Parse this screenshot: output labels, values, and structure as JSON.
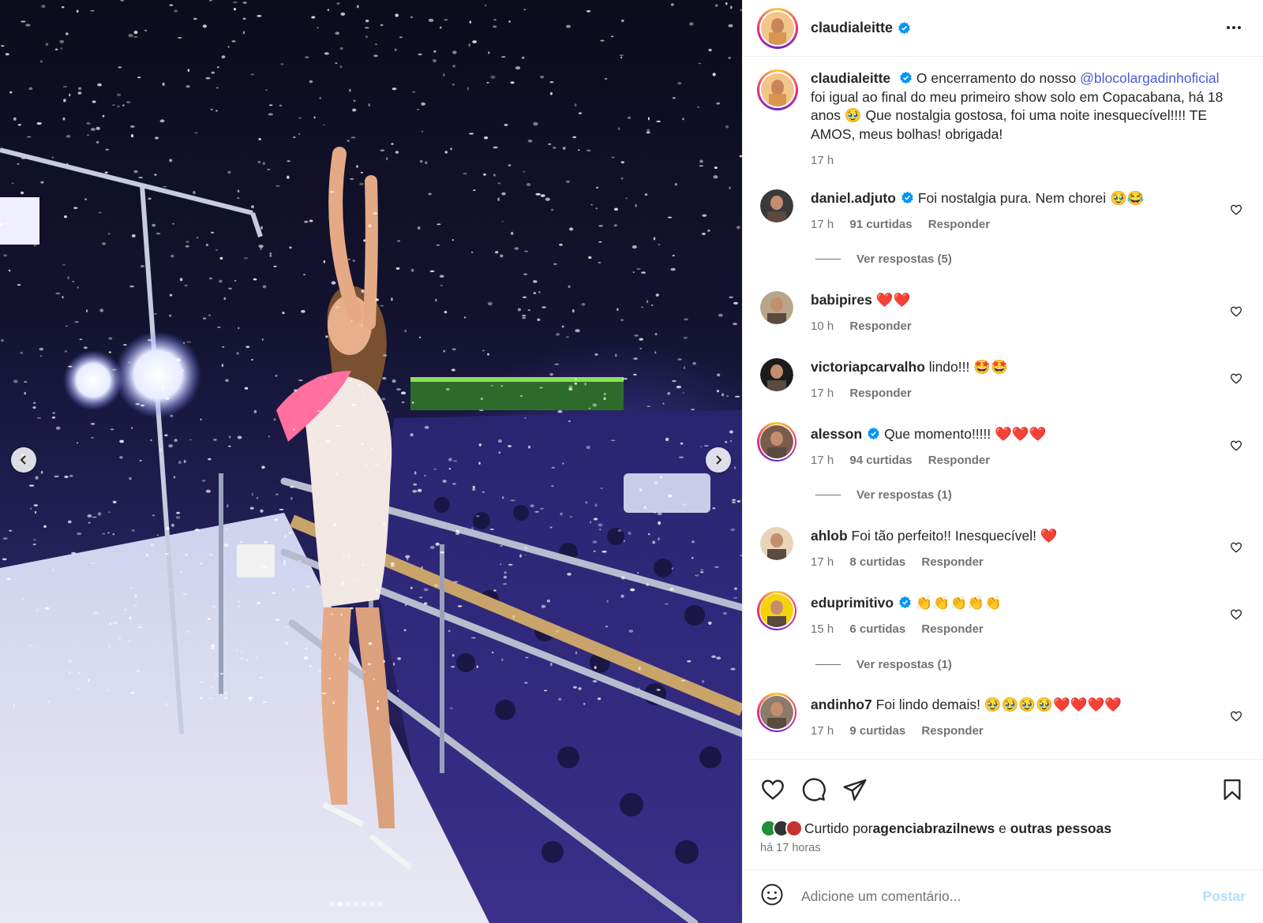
{
  "post": {
    "author": "claudialeitte",
    "caption_pre": "O encerramento do nosso ",
    "caption_mention": "@blocolargadinhoficial",
    "caption_post": " foi igual ao final do meu primeiro show solo em Copacabana, há 18 anos 🥹 Que nostalgia gostosa, foi uma noite inesquecível!!!! TE AMOS, meus bolhas! obrigada!",
    "caption_time": "17 h"
  },
  "comments": [
    {
      "user": "daniel.adjuto",
      "verified": true,
      "text": "Foi nostalgia pura. Nem chorei 🥹😂",
      "time": "17 h",
      "likes": "91 curtidas",
      "reply": "Responder",
      "view_replies": "Ver respostas (5)"
    },
    {
      "user": "babipires",
      "verified": false,
      "text": "❤️❤️",
      "time": "10 h",
      "likes": "",
      "reply": "Responder",
      "view_replies": ""
    },
    {
      "user": "victoriapcarvalho",
      "verified": false,
      "text": "lindo!!! 🤩🤩",
      "time": "17 h",
      "likes": "",
      "reply": "Responder",
      "view_replies": ""
    },
    {
      "user": "alesson",
      "verified": true,
      "text": "Que momento!!!!! ❤️❤️❤️",
      "time": "17 h",
      "likes": "94 curtidas",
      "reply": "Responder",
      "view_replies": "Ver respostas (1)"
    },
    {
      "user": "ahlob",
      "verified": false,
      "text": "Foi tão perfeito!! Inesquecível! ❤️",
      "time": "17 h",
      "likes": "8 curtidas",
      "reply": "Responder",
      "view_replies": ""
    },
    {
      "user": "eduprimitivo",
      "verified": true,
      "text": "👏👏👏👏👏",
      "time": "15 h",
      "likes": "6 curtidas",
      "reply": "Responder",
      "view_replies": "Ver respostas (1)"
    },
    {
      "user": "andinho7",
      "verified": false,
      "text": "Foi lindo demais! 🥹🥹🥹🥹❤️❤️❤️❤️",
      "time": "17 h",
      "likes": "9 curtidas",
      "reply": "Responder",
      "view_replies": ""
    }
  ],
  "likes_line": {
    "prefix": "Curtido por ",
    "user": "agenciabrazilnews",
    "middle": " e ",
    "others": "outras pessoas"
  },
  "time_ago": "há 17 horas",
  "comment_input": {
    "placeholder": "Adicione um comentário..."
  },
  "post_button": "Postar",
  "icons": {
    "more": "more-horizontal-icon",
    "verified": "verified-badge-icon",
    "like": "heart-icon",
    "comment": "comment-icon",
    "share": "send-icon",
    "save": "bookmark-icon",
    "emoji": "emoji-icon",
    "prev": "chevron-left-icon",
    "next": "chevron-right-icon"
  },
  "colors": {
    "verified": "#0095f6",
    "link": "#4a5dd8",
    "secondary": "#737373",
    "post_disabled": "#b2dffc"
  },
  "carousel": {
    "slides": 7,
    "active_index": 1
  }
}
